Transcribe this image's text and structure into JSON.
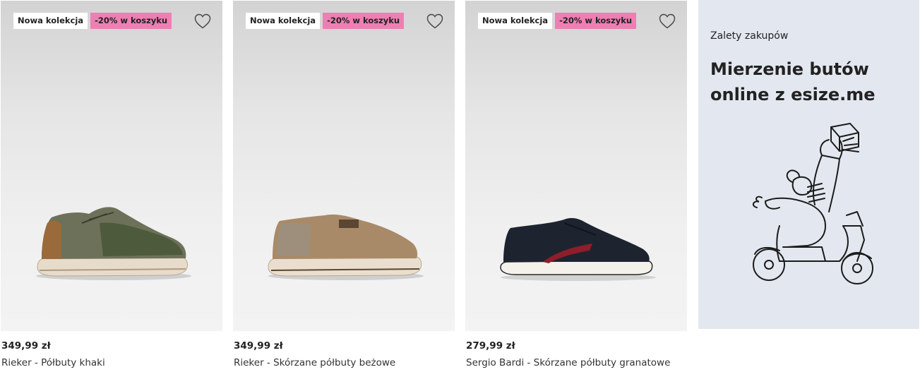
{
  "products": [
    {
      "badge_new": "Nowa kolekcja",
      "badge_promo": "-20% w koszyku",
      "price": "349,99 zł",
      "name": "Rieker - Półbuty khaki",
      "favorite_icon": "heart-outline-icon"
    },
    {
      "badge_new": "Nowa kolekcja",
      "badge_promo": "-20% w koszyku",
      "price": "349,99 zł",
      "name": "Rieker - Skórzane półbuty beżowe",
      "favorite_icon": "heart-outline-icon"
    },
    {
      "badge_new": "Nowa kolekcja",
      "badge_promo": "-20% w koszyku",
      "price": "279,99 zł",
      "name": "Sergio Bardi - Skórzane półbuty granatowe",
      "favorite_icon": "heart-outline-icon"
    }
  ],
  "promo": {
    "eyebrow": "Zalety zakupów",
    "title": "Mierzenie butów online z esize.me"
  },
  "colors": {
    "promo_badge": "#ee7fb3",
    "promo_card_bg": "#e3e8f0",
    "image_bg": "#e6e6e6"
  }
}
